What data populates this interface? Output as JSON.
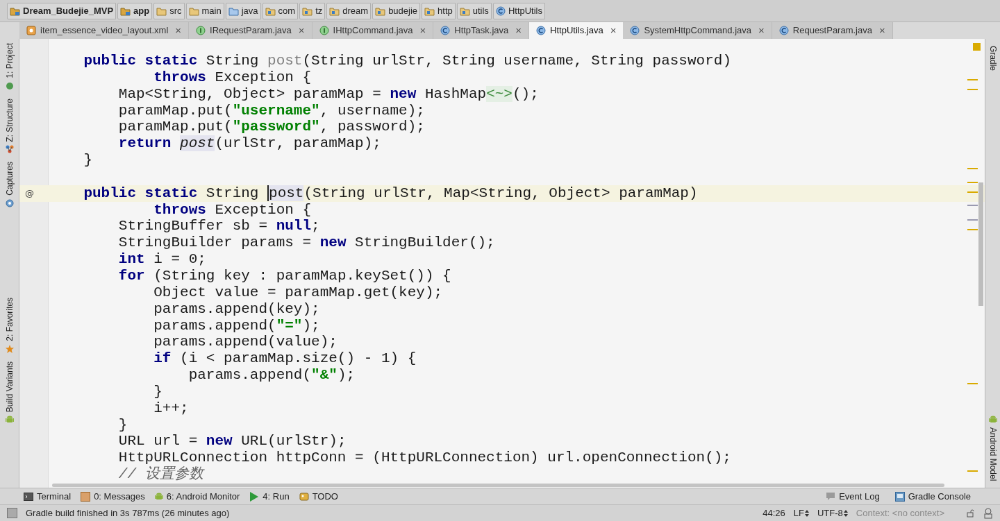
{
  "breadcrumbs": [
    {
      "label": "Dream_Budejie_MVP",
      "kind": "module"
    },
    {
      "label": "app",
      "kind": "module"
    },
    {
      "label": "src",
      "kind": "folder"
    },
    {
      "label": "main",
      "kind": "folder"
    },
    {
      "label": "java",
      "kind": "source"
    },
    {
      "label": "com",
      "kind": "package"
    },
    {
      "label": "tz",
      "kind": "package"
    },
    {
      "label": "dream",
      "kind": "package"
    },
    {
      "label": "budejie",
      "kind": "package"
    },
    {
      "label": "http",
      "kind": "package"
    },
    {
      "label": "utils",
      "kind": "package"
    },
    {
      "label": "HttpUtils",
      "kind": "class"
    }
  ],
  "tabs": [
    {
      "label": "item_essence_video_layout.xml",
      "kind": "xml",
      "selected": false,
      "close": "×"
    },
    {
      "label": "IRequestParam.java",
      "kind": "interface",
      "selected": false,
      "close": "×"
    },
    {
      "label": "IHttpCommand.java",
      "kind": "interface",
      "selected": false,
      "close": "×"
    },
    {
      "label": "HttpTask.java",
      "kind": "class",
      "selected": false,
      "close": "×"
    },
    {
      "label": "HttpUtils.java",
      "kind": "class",
      "selected": true,
      "close": "×"
    },
    {
      "label": "SystemHttpCommand.java",
      "kind": "class",
      "selected": false,
      "close": "×"
    },
    {
      "label": "RequestParam.java",
      "kind": "class",
      "selected": false,
      "close": "×"
    }
  ],
  "left_tool_tabs": [
    {
      "label": "1: Project",
      "kind": "project"
    },
    {
      "label": "Z: Structure",
      "kind": "structure"
    },
    {
      "label": "Captures",
      "kind": "captures"
    },
    {
      "label": "2: Favorites",
      "kind": "favorites"
    },
    {
      "label": "Build Variants",
      "kind": "android"
    }
  ],
  "right_tool_tabs": [
    {
      "label": "Gradle",
      "kind": "gradle"
    },
    {
      "label": "Android Model",
      "kind": "android"
    }
  ],
  "code_lines": [
    {
      "tokens": [
        {
          "kind": "kw",
          "text": "    public static "
        },
        {
          "kind": "plain",
          "text": "String "
        },
        {
          "kind": "unused",
          "text": "post"
        },
        {
          "kind": "plain",
          "text": "(String urlStr, String username, String password)"
        }
      ]
    },
    {
      "tokens": [
        {
          "kind": "kw",
          "text": "            throws "
        },
        {
          "kind": "plain",
          "text": "Exception {"
        }
      ]
    },
    {
      "tokens": [
        {
          "kind": "plain",
          "text": "        Map<String, Object> paramMap = "
        },
        {
          "kind": "kw",
          "text": "new "
        },
        {
          "kind": "plain",
          "text": "HashMap"
        },
        {
          "kind": "fold",
          "text": "<~>"
        },
        {
          "kind": "plain",
          "text": "();"
        }
      ]
    },
    {
      "tokens": [
        {
          "kind": "plain",
          "text": "        paramMap.put("
        },
        {
          "kind": "str",
          "text": "\"username\""
        },
        {
          "kind": "plain",
          "text": ", username);"
        }
      ]
    },
    {
      "tokens": [
        {
          "kind": "plain",
          "text": "        paramMap.put("
        },
        {
          "kind": "str",
          "text": "\"password\""
        },
        {
          "kind": "plain",
          "text": ", password);"
        }
      ]
    },
    {
      "tokens": [
        {
          "kind": "kw",
          "text": "        return "
        },
        {
          "kind": "static",
          "text": "post"
        },
        {
          "kind": "plain",
          "text": "(urlStr, paramMap);"
        }
      ]
    },
    {
      "tokens": [
        {
          "kind": "plain",
          "text": "    }"
        }
      ]
    },
    {
      "blank_line_above": true,
      "current": true,
      "gutter": "@",
      "tokens": [
        {
          "kind": "kw",
          "text": "    public static "
        },
        {
          "kind": "plain",
          "text": "String "
        },
        {
          "kind": "caret",
          "text": "post"
        },
        {
          "kind": "plain",
          "text": "(String urlStr, Map<String, Object> paramMap)"
        }
      ]
    },
    {
      "tokens": [
        {
          "kind": "kw",
          "text": "            throws "
        },
        {
          "kind": "plain",
          "text": "Exception {"
        }
      ]
    },
    {
      "tokens": [
        {
          "kind": "plain",
          "text": "        StringBuffer sb = "
        },
        {
          "kind": "kw",
          "text": "null"
        },
        {
          "kind": "plain",
          "text": ";"
        }
      ]
    },
    {
      "tokens": [
        {
          "kind": "plain",
          "text": "        StringBuilder params = "
        },
        {
          "kind": "kw",
          "text": "new "
        },
        {
          "kind": "plain",
          "text": "StringBuilder();"
        }
      ]
    },
    {
      "tokens": [
        {
          "kind": "kw",
          "text": "        int "
        },
        {
          "kind": "plain",
          "text": "i = 0;"
        }
      ]
    },
    {
      "tokens": [
        {
          "kind": "kw",
          "text": "        for "
        },
        {
          "kind": "plain",
          "text": "(String key : paramMap.keySet()) {"
        }
      ]
    },
    {
      "tokens": [
        {
          "kind": "plain",
          "text": "            Object value = paramMap.get(key);"
        }
      ]
    },
    {
      "tokens": [
        {
          "kind": "plain",
          "text": "            params.append(key);"
        }
      ]
    },
    {
      "tokens": [
        {
          "kind": "plain",
          "text": "            params.append("
        },
        {
          "kind": "str",
          "text": "\"=\""
        },
        {
          "kind": "plain",
          "text": ");"
        }
      ]
    },
    {
      "tokens": [
        {
          "kind": "plain",
          "text": "            params.append(value);"
        }
      ]
    },
    {
      "tokens": [
        {
          "kind": "kw",
          "text": "            if "
        },
        {
          "kind": "plain",
          "text": "(i < paramMap.size() - 1) {"
        }
      ]
    },
    {
      "tokens": [
        {
          "kind": "plain",
          "text": "                params.append("
        },
        {
          "kind": "str",
          "text": "\"&\""
        },
        {
          "kind": "plain",
          "text": ");"
        }
      ]
    },
    {
      "tokens": [
        {
          "kind": "plain",
          "text": "            }"
        }
      ]
    },
    {
      "tokens": [
        {
          "kind": "plain",
          "text": "            i++;"
        }
      ]
    },
    {
      "tokens": [
        {
          "kind": "plain",
          "text": "        }"
        }
      ]
    },
    {
      "tokens": [
        {
          "kind": "plain",
          "text": "        URL url = "
        },
        {
          "kind": "kw",
          "text": "new "
        },
        {
          "kind": "plain",
          "text": "URL(urlStr);"
        }
      ]
    },
    {
      "tokens": [
        {
          "kind": "plain",
          "text": "        HttpURLConnection httpConn = (HttpURLConnection) url.openConnection();"
        }
      ]
    },
    {
      "tokens": [
        {
          "kind": "comment",
          "text": "        // 设置参数"
        }
      ]
    }
  ],
  "bottom_tool_tabs": [
    {
      "label": "Terminal",
      "kind": "terminal"
    },
    {
      "label": "0: Messages",
      "kind": "messages"
    },
    {
      "label": "6: Android Monitor",
      "kind": "android"
    },
    {
      "label": "4: Run",
      "kind": "run"
    },
    {
      "label": "TODO",
      "kind": "todo"
    }
  ],
  "bottom_tool_tabs_right": [
    {
      "label": "Event Log",
      "kind": "log"
    },
    {
      "label": "Gradle Console",
      "kind": "console"
    }
  ],
  "status_bar": {
    "message": "Gradle build finished in 3s 787ms (26 minutes ago)",
    "position": "44:26",
    "line_separator": "LF",
    "encoding": "UTF-8",
    "context": "Context: <no context>"
  }
}
